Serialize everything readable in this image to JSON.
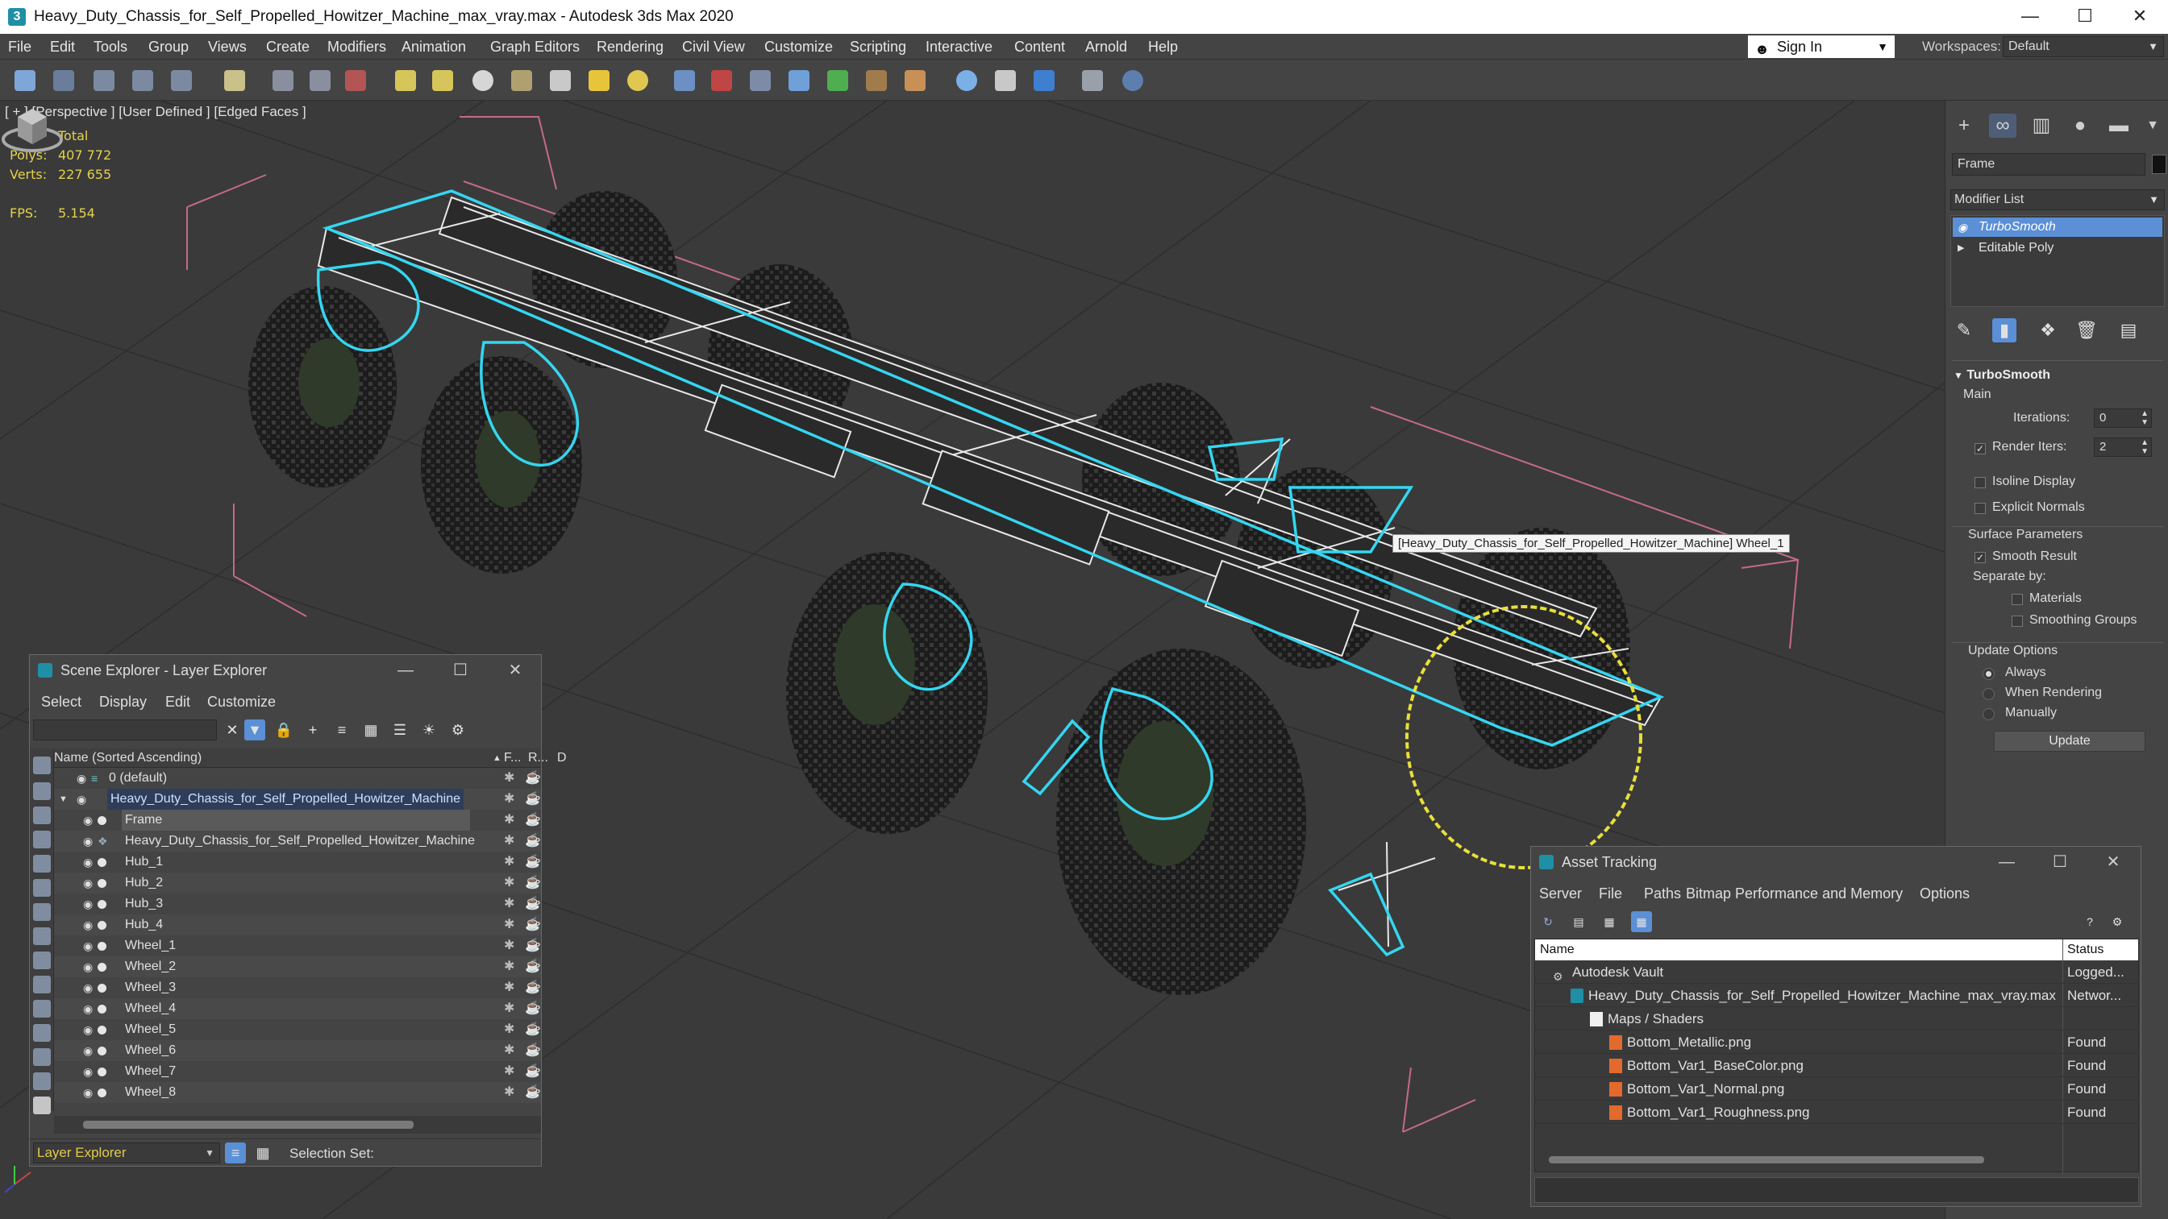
{
  "window": {
    "title": "Heavy_Duty_Chassis_for_Self_Propelled_Howitzer_Machine_max_vray.max - Autodesk 3ds Max 2020",
    "minimize": "—",
    "maximize": "☐",
    "close": "✕"
  },
  "menu": {
    "items": [
      "File",
      "Edit",
      "Tools",
      "Group",
      "Views",
      "Create",
      "Modifiers",
      "Animation",
      "Graph Editors",
      "Rendering",
      "Civil View",
      "Customize",
      "Scripting",
      "Interactive",
      "Content",
      "Arnold",
      "Help"
    ],
    "sign_in": "Sign In",
    "workspaces_label": "Workspaces:",
    "workspace_value": "Default"
  },
  "viewport": {
    "label": "[ + ] [Perspective ] [User Defined ] [Edged Faces ]",
    "stats": {
      "total_label": "Total",
      "polys_label": "Polys:",
      "polys_value": "407 772",
      "verts_label": "Verts:",
      "verts_value": "227 655",
      "fps_label": "FPS:",
      "fps_value": "5.154"
    },
    "tooltip": "[Heavy_Duty_Chassis_for_Self_Propelled_Howitzer_Machine] Wheel_1"
  },
  "command_panel": {
    "object_name": "Frame",
    "modifier_list": "Modifier List",
    "stack": [
      "TurboSmooth",
      "Editable Poly"
    ],
    "rollout_title": "TurboSmooth",
    "main_label": "Main",
    "iterations_label": "Iterations:",
    "iterations_value": "0",
    "render_iters_label": "Render Iters:",
    "render_iters_value": "2",
    "render_iters_checked": true,
    "isoline_display": "Isoline Display",
    "explicit_normals": "Explicit Normals",
    "surface_params": "Surface Parameters",
    "smooth_result": "Smooth Result",
    "separate_by": "Separate by:",
    "materials": "Materials",
    "smoothing_groups": "Smoothing Groups",
    "update_options": "Update Options",
    "always": "Always",
    "when_rendering": "When Rendering",
    "manually": "Manually",
    "update_button": "Update"
  },
  "scene_explorer": {
    "title": "Scene Explorer - Layer Explorer",
    "menu": [
      "Select",
      "Display",
      "Edit",
      "Customize"
    ],
    "col_name": "Name (Sorted Ascending)",
    "col_f": "F...",
    "col_r": "R...",
    "col_d": "D",
    "rows": [
      {
        "name": "0 (default)",
        "level": 1
      },
      {
        "name": "Heavy_Duty_Chassis_for_Self_Propelled_Howitzer_Machine",
        "level": 1
      },
      {
        "name": "Frame",
        "level": 2
      },
      {
        "name": "Heavy_Duty_Chassis_for_Self_Propelled_Howitzer_Machine",
        "level": 2
      },
      {
        "name": "Hub_1",
        "level": 2
      },
      {
        "name": "Hub_2",
        "level": 2
      },
      {
        "name": "Hub_3",
        "level": 2
      },
      {
        "name": "Hub_4",
        "level": 2
      },
      {
        "name": "Wheel_1",
        "level": 2
      },
      {
        "name": "Wheel_2",
        "level": 2
      },
      {
        "name": "Wheel_3",
        "level": 2
      },
      {
        "name": "Wheel_4",
        "level": 2
      },
      {
        "name": "Wheel_5",
        "level": 2
      },
      {
        "name": "Wheel_6",
        "level": 2
      },
      {
        "name": "Wheel_7",
        "level": 2
      },
      {
        "name": "Wheel_8",
        "level": 2
      }
    ],
    "footer_layer": "Layer Explorer",
    "selection_set_label": "Selection Set:"
  },
  "asset_tracking": {
    "title": "Asset Tracking",
    "menu": [
      "Server",
      "File",
      "Paths",
      "Bitmap Performance and Memory",
      "Options"
    ],
    "col_name": "Name",
    "col_status": "Status",
    "rows": [
      {
        "name": "Autodesk Vault",
        "status": "Logged..."
      },
      {
        "name": "Heavy_Duty_Chassis_for_Self_Propelled_Howitzer_Machine_max_vray.max",
        "status": "Networ..."
      },
      {
        "name": "Maps / Shaders",
        "status": ""
      },
      {
        "name": "Bottom_Metallic.png",
        "status": "Found"
      },
      {
        "name": "Bottom_Var1_BaseColor.png",
        "status": "Found"
      },
      {
        "name": "Bottom_Var1_Normal.png",
        "status": "Found"
      },
      {
        "name": "Bottom_Var1_Roughness.png",
        "status": "Found"
      }
    ]
  },
  "colors": {
    "selection_cyan": "#35d6f0",
    "highlight_yellow": "#e8df3a",
    "accent_blue": "#5b8fd6"
  }
}
